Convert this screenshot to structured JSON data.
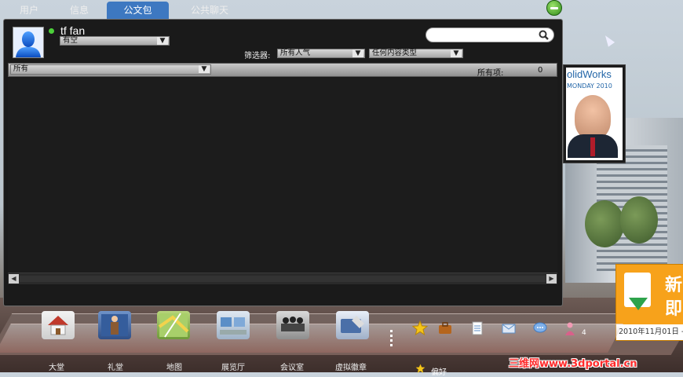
{
  "tabs": [
    {
      "label": "用户"
    },
    {
      "label": "信息"
    },
    {
      "label": "公文包",
      "active": true
    },
    {
      "label": "公共聊天"
    }
  ],
  "user": {
    "name": "tf fan",
    "status": "有空",
    "status_color": "#4cd03a"
  },
  "search": {
    "placeholder": ""
  },
  "filters": {
    "label": "筛选器:",
    "popularity_value": "所有人气",
    "type_value": "任何内容类型"
  },
  "category": {
    "value": "所有",
    "total_label": "所有项:",
    "total_value": "0"
  },
  "poster": {
    "line1": "olidWorks",
    "line2": "MONDAY 2010"
  },
  "ad": {
    "line1": "新",
    "line2": "即",
    "date": "2010年11月01日 -"
  },
  "dock": {
    "items": [
      {
        "label": "大堂",
        "icon": "house-icon"
      },
      {
        "label": "礼堂",
        "icon": "auditorium-icon"
      },
      {
        "label": "地图",
        "icon": "map-icon"
      },
      {
        "label": "展览厅",
        "icon": "exhibit-hall-icon"
      },
      {
        "label": "会议室",
        "icon": "meeting-room-icon"
      },
      {
        "label": "虚拟徽章",
        "icon": "virtual-badge-icon"
      }
    ],
    "tray": [
      "star-icon",
      "briefcase-icon",
      "notepad-icon",
      "mail-icon",
      "chat-icon",
      "person-icon"
    ],
    "tray_count": "4",
    "pref_label": "偏好"
  },
  "watermark": "三维网www.3dportal.cn",
  "colors": {
    "accent": "#3d78c1",
    "panel": "#1a1a1a"
  }
}
